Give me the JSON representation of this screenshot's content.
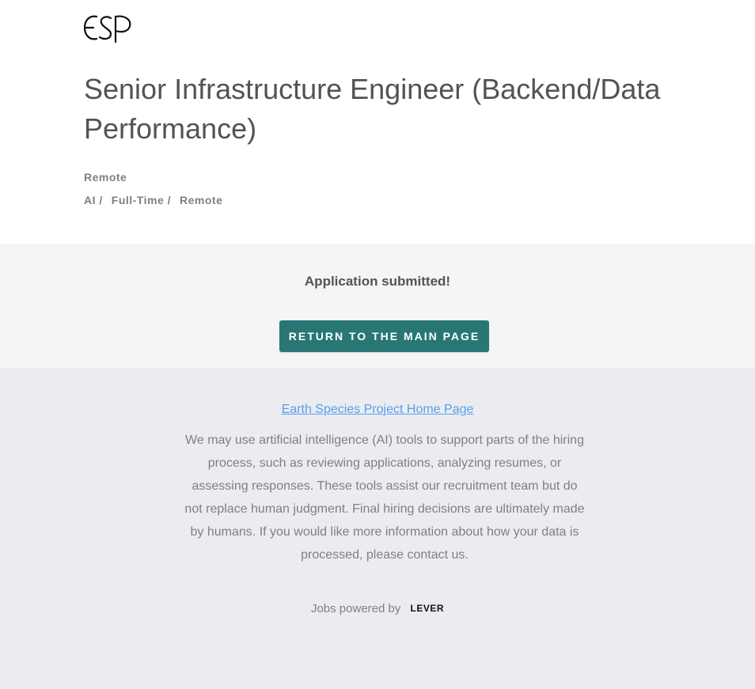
{
  "header": {
    "logo_icon": "esp-logo-icon",
    "job_title": "Senior Infrastructure Engineer (Backend/Data Performance)",
    "location": "Remote",
    "categories": [
      "AI /",
      "Full-Time /",
      "Remote"
    ]
  },
  "confirmation": {
    "message": "Application submitted!",
    "return_button_label": "RETURN TO THE MAIN PAGE",
    "button_color": "#287676"
  },
  "footer": {
    "home_link": "Earth Species Project Home Page",
    "disclaimer": "We may use artificial intelligence (AI) tools to support parts of the hiring process, such as reviewing applications, analyzing resumes, or assessing responses. These tools assist our recruitment team but do not replace human judgment. Final hiring decisions are ultimately made by humans. If you would like more information about how your data is processed, please contact us.",
    "powered_by": "Jobs powered by",
    "lever_logo": "LEVER",
    "link_color": "#579eee"
  }
}
